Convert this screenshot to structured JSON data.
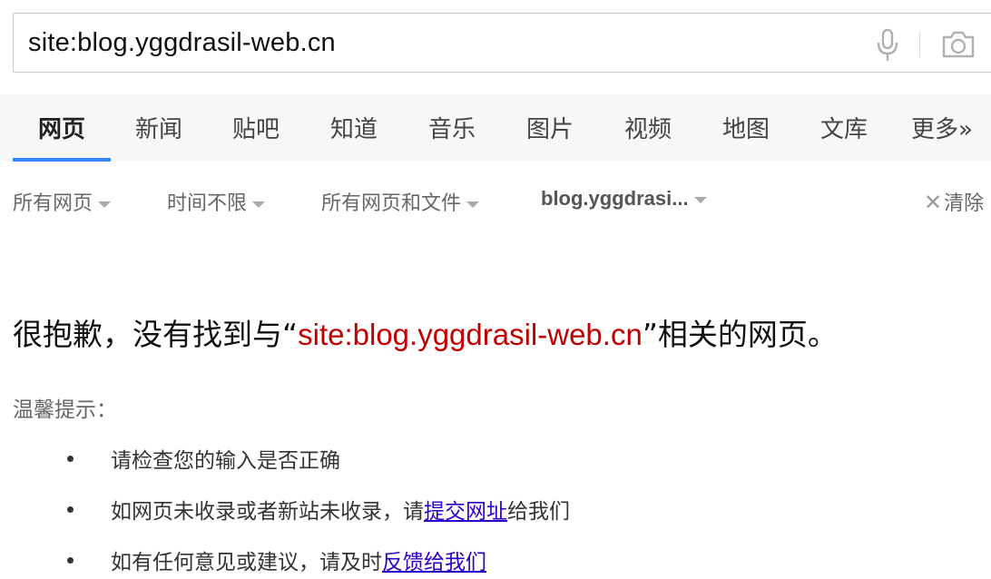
{
  "search": {
    "query": "site:blog.yggdrasil-web.cn"
  },
  "tabs": [
    {
      "label": "网页",
      "active": true
    },
    {
      "label": "新闻"
    },
    {
      "label": "贴吧"
    },
    {
      "label": "知道"
    },
    {
      "label": "音乐"
    },
    {
      "label": "图片"
    },
    {
      "label": "视频"
    },
    {
      "label": "地图"
    },
    {
      "label": "文库"
    },
    {
      "label": "更多»"
    }
  ],
  "filters": {
    "all_pages": "所有网页",
    "time": "时间不限",
    "file_type": "所有网页和文件",
    "site": "blog.yggdrasi...",
    "clear": "清除"
  },
  "result": {
    "sorry_prefix": "很抱歉，没有找到与“",
    "query": "site:blog.yggdrasil-web.cn",
    "sorry_suffix": "”相关的网页。"
  },
  "tips": {
    "title": "温馨提示：",
    "item1": "请检查您的输入是否正确",
    "item2_prefix": "如网页未收录或者新站未收录，请",
    "item2_link": "提交网址",
    "item2_suffix": "给我们",
    "item3_prefix": "如有任何意见或建议，请及时",
    "item3_link": "反馈给我们"
  },
  "colors": {
    "accent": "#3388ff",
    "query_red": "#c00000",
    "link": "#2a00c8"
  },
  "icons": [
    "microphone-icon",
    "camera-icon",
    "caret-down-icon",
    "close-icon"
  ]
}
